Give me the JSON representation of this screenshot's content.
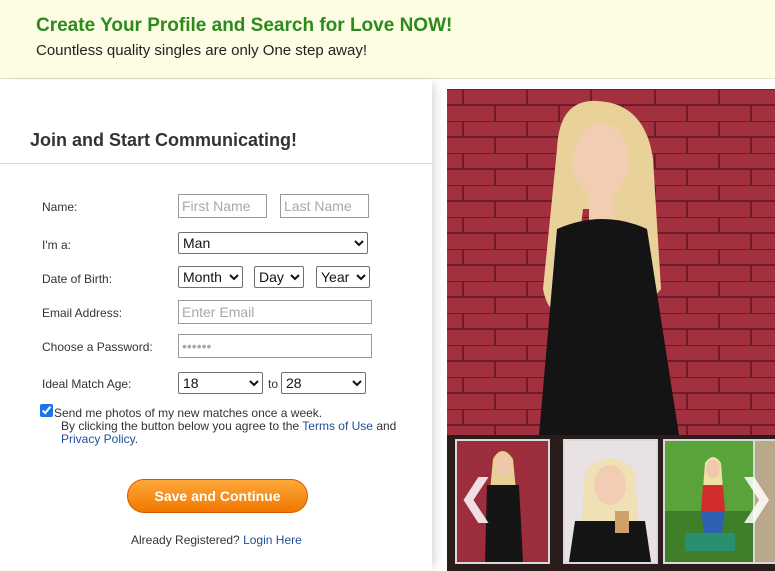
{
  "banner": {
    "title": "Create Your Profile and Search for Love NOW!",
    "subtitle": "Countless quality singles are only One step away!"
  },
  "form": {
    "heading": "Join and Start Communicating!",
    "name_label": "Name:",
    "first_name_placeholder": "First Name",
    "last_name_placeholder": "Last Name",
    "gender_label": "I'm a:",
    "gender_value": "Man",
    "dob_label": "Date of Birth:",
    "month_value": "Month",
    "day_value": "Day",
    "year_value": "Year",
    "email_label": "Email Address:",
    "email_placeholder": "Enter Email",
    "password_label": "Choose a Password:",
    "password_placeholder": "••••••",
    "age_label": "Ideal Match Age:",
    "age_from": "18",
    "age_to_text": "to",
    "age_to": "28",
    "photos_checkbox_checked": true,
    "photos_text": "Send me photos of my new matches once a week.",
    "terms_text": "By clicking the button below you agree to the",
    "terms_link": "Terms of Use",
    "and_text": "and",
    "privacy_link": "Privacy Policy",
    "period": ".",
    "submit_label": "Save and Continue",
    "already_text": "Already Registered?",
    "login_link": "Login Here"
  },
  "gallery": {
    "prev_icon": "chevron-left-icon",
    "next_icon": "chevron-right-icon",
    "prev_glyph": "❮",
    "next_glyph": "❯"
  },
  "colors": {
    "banner_title": "#2d8a1f",
    "button": "#f07800",
    "link": "#1f4f9a",
    "photo_wall": "#9a2e3e"
  }
}
